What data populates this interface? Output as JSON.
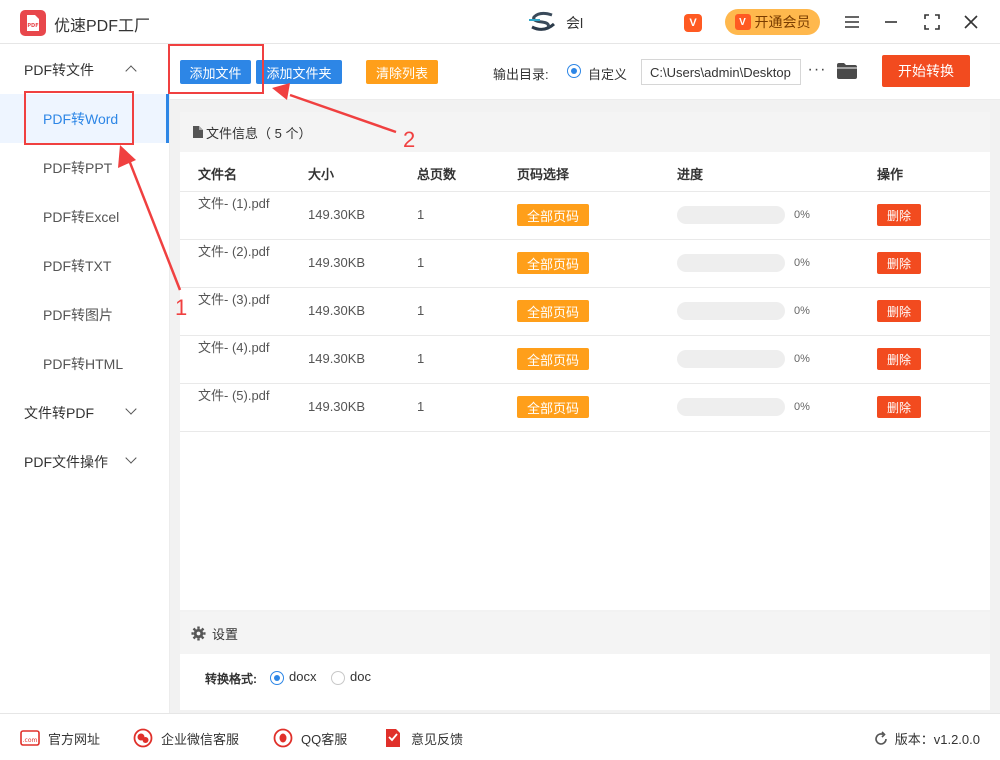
{
  "app": {
    "title": "优速PDF工厂",
    "center_text": "会l",
    "vip_label": "开通会员",
    "vip_badge_letter": "V"
  },
  "sidebar": {
    "groups": [
      {
        "label": "PDF转文件",
        "expanded": true,
        "items": [
          "PDF转Word",
          "PDF转PPT",
          "PDF转Excel",
          "PDF转TXT",
          "PDF转图片",
          "PDF转HTML"
        ]
      },
      {
        "label": "文件转PDF",
        "expanded": false
      },
      {
        "label": "PDF文件操作",
        "expanded": false
      }
    ],
    "active_item": "PDF转Word"
  },
  "toolbar": {
    "add_file": "添加文件",
    "add_folder": "添加文件夹",
    "clear_list": "清除列表",
    "output_label": "输出目录:",
    "output_option": "自定义",
    "output_path": "C:\\Users\\admin\\Desktop",
    "more": "···",
    "start": "开始转换"
  },
  "file_panel": {
    "title": "文件信息（ 5 个）",
    "columns": [
      "文件名",
      "大小",
      "总页数",
      "页码选择",
      "进度",
      "操作"
    ],
    "rows": [
      {
        "name": "文件- (1).pdf",
        "size": "149.30KB",
        "pages": "1",
        "page_select": "全部页码",
        "progress": "0%",
        "action": "删除"
      },
      {
        "name": "文件- (2).pdf",
        "size": "149.30KB",
        "pages": "1",
        "page_select": "全部页码",
        "progress": "0%",
        "action": "删除"
      },
      {
        "name": "文件- (3).pdf",
        "size": "149.30KB",
        "pages": "1",
        "page_select": "全部页码",
        "progress": "0%",
        "action": "删除"
      },
      {
        "name": "文件- (4).pdf",
        "size": "149.30KB",
        "pages": "1",
        "page_select": "全部页码",
        "progress": "0%",
        "action": "删除"
      },
      {
        "name": "文件- (5).pdf",
        "size": "149.30KB",
        "pages": "1",
        "page_select": "全部页码",
        "progress": "0%",
        "action": "删除"
      }
    ]
  },
  "settings": {
    "title": "设置",
    "format_label": "转换格式:",
    "formats": [
      "docx",
      "doc"
    ],
    "selected_format": "docx"
  },
  "footer": {
    "links": [
      "官方网址",
      "企业微信客服",
      "QQ客服",
      "意见反馈"
    ],
    "version": "版本：v1.2.0.0"
  },
  "annotations": {
    "marker1": "1",
    "marker2": "2"
  },
  "colors": {
    "accent_blue": "#2d86e6",
    "accent_orange": "#ff9f1a",
    "danger_red": "#f24b1f",
    "annotation_red": "#f04040"
  }
}
